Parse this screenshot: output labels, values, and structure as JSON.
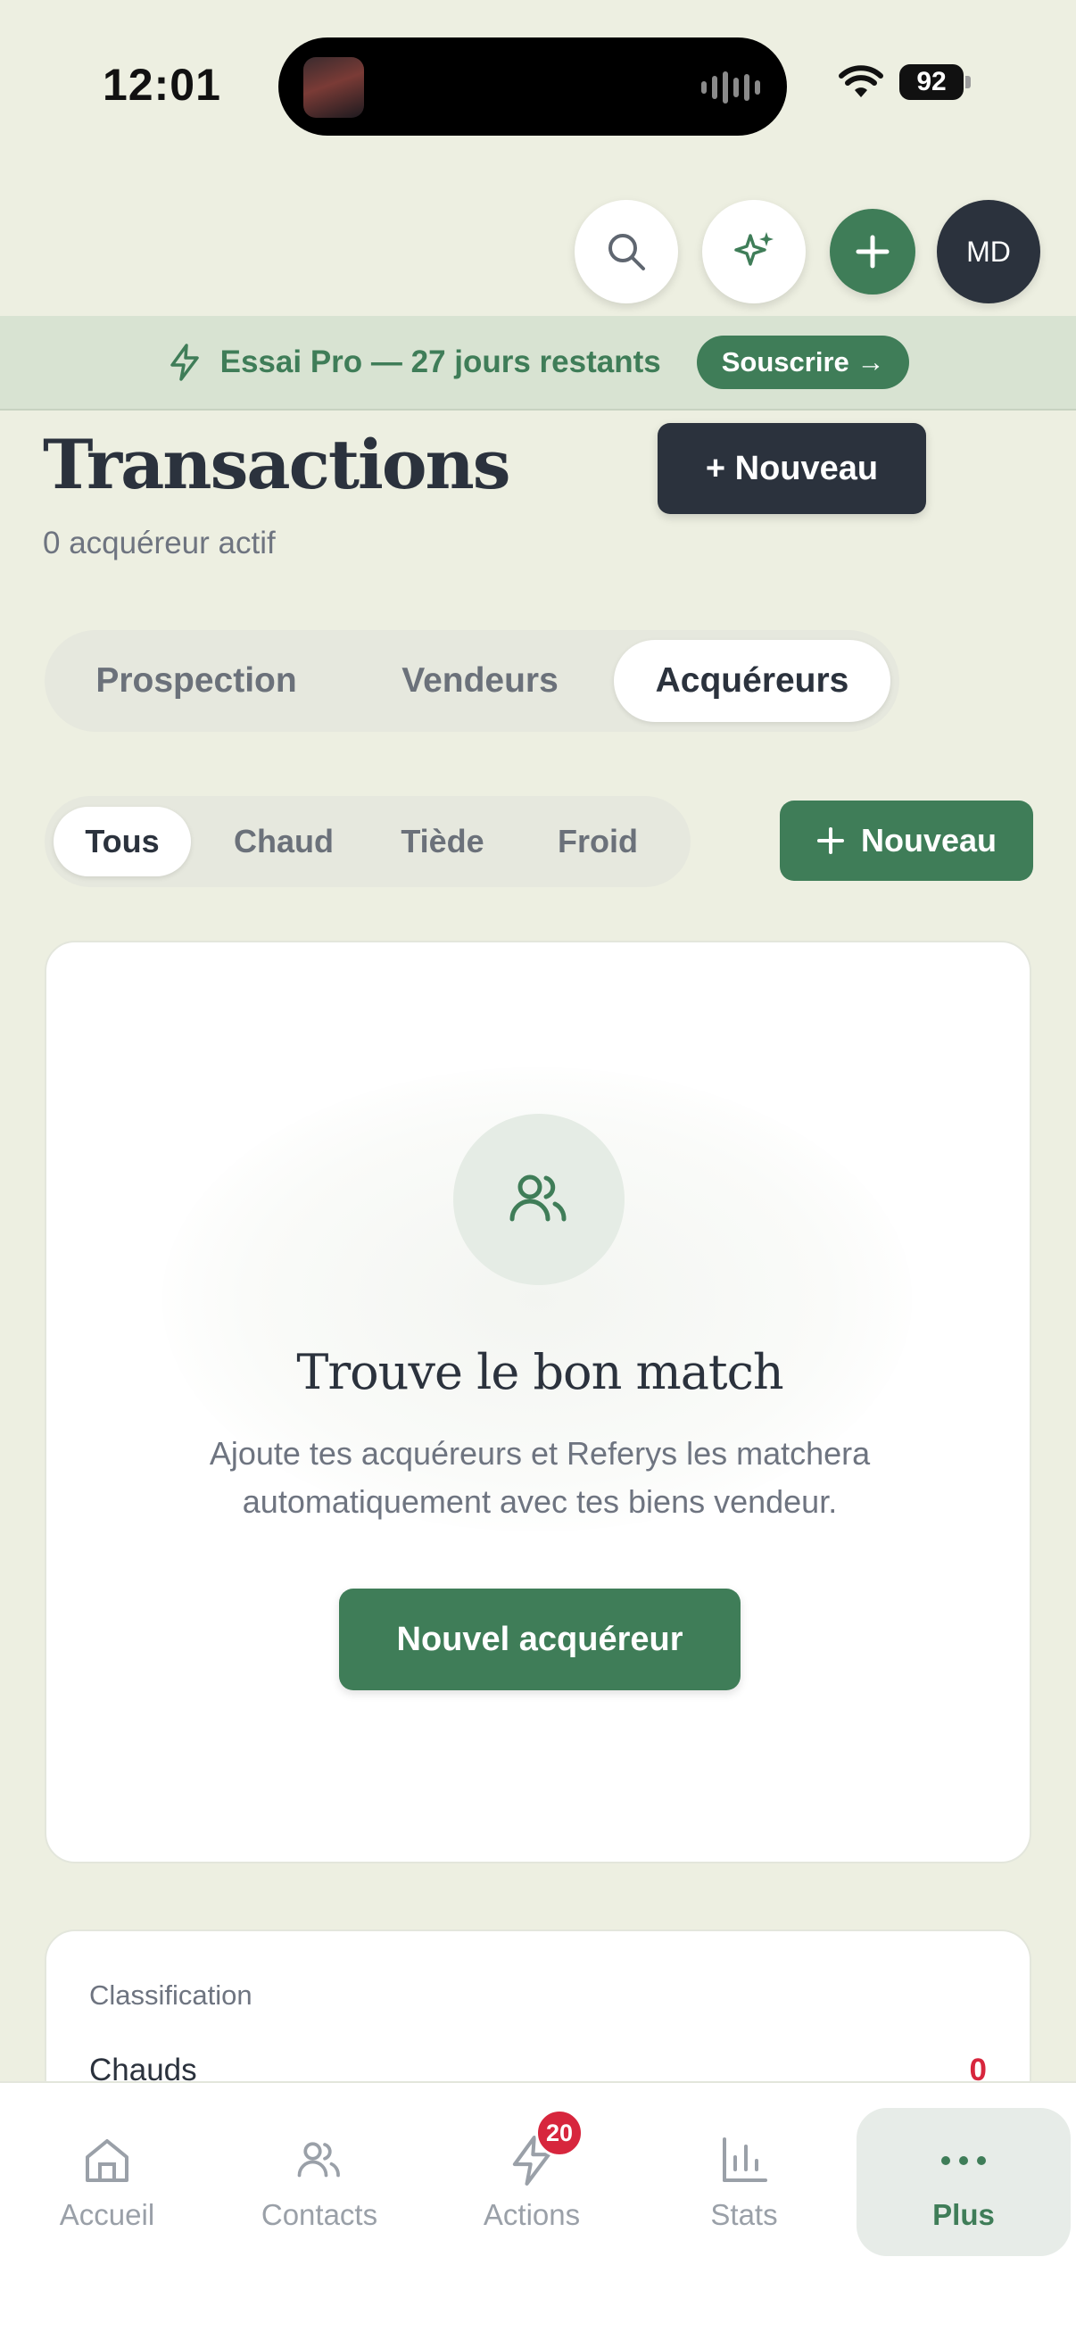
{
  "status_bar": {
    "time": "12:01",
    "battery": "92"
  },
  "top_actions": {
    "avatar_initials": "MD"
  },
  "trial_banner": {
    "text": "Essai Pro — 27 jours restants",
    "cta": "Souscrire →"
  },
  "header": {
    "title": "Transactions",
    "subtitle": "0 acquéreur actif",
    "new_label": "+ Nouveau"
  },
  "main_tabs": [
    {
      "label": "Prospection",
      "active": false
    },
    {
      "label": "Vendeurs",
      "active": false
    },
    {
      "label": "Acquéreurs",
      "active": true
    }
  ],
  "filters": [
    {
      "label": "Tous",
      "active": true
    },
    {
      "label": "Chaud",
      "active": false
    },
    {
      "label": "Tiède",
      "active": false
    },
    {
      "label": "Froid",
      "active": false
    }
  ],
  "filter_new_label": "Nouveau",
  "empty_state": {
    "title": "Trouve le bon match",
    "description": "Ajoute tes acquéreurs et Referys les matchera automatiquement avec tes biens vendeur.",
    "button": "Nouvel acquéreur"
  },
  "classification": {
    "label": "Classification",
    "rows": [
      {
        "label": "Chauds",
        "value": "0"
      }
    ]
  },
  "bottom_nav": [
    {
      "label": "Accueil",
      "icon": "home-icon"
    },
    {
      "label": "Contacts",
      "icon": "users-icon"
    },
    {
      "label": "Actions",
      "icon": "bolt-icon",
      "badge": "20"
    },
    {
      "label": "Stats",
      "icon": "bar-chart-icon"
    },
    {
      "label": "Plus",
      "icon": "more-dots-icon",
      "active": true
    }
  ],
  "colors": {
    "accent": "#3f7d58",
    "dark": "#2b323d",
    "background": "#edefe1",
    "alert": "#d7263d"
  }
}
